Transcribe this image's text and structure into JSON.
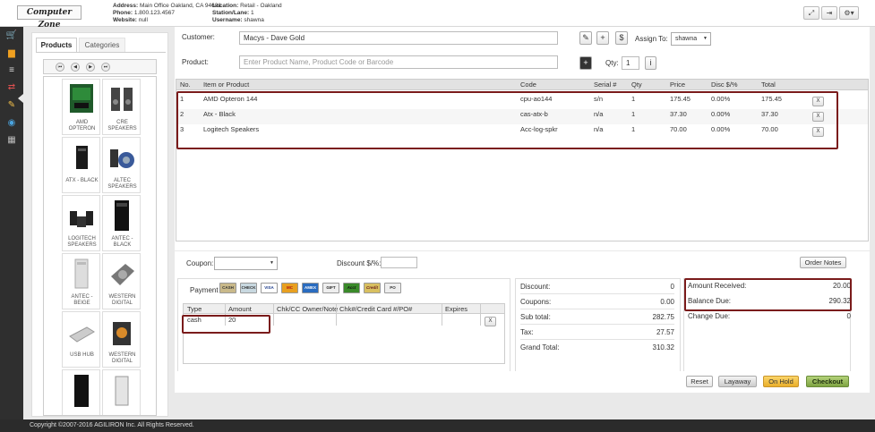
{
  "header": {
    "logo": "Computer Zone",
    "address_label": "Address:",
    "address": "Main Office Oakland, CA 94601",
    "phone_label": "Phone:",
    "phone": "1.800.123.4567",
    "website_label": "Website:",
    "website": "null",
    "location_label": "Location:",
    "location": "Retail - Oakland",
    "station_label": "Station/Lane:",
    "station": "1",
    "username_label": "Username:",
    "username": "shawna",
    "icons": [
      "expand-icon",
      "logout-icon",
      "gear-icon"
    ]
  },
  "rail": {
    "icons": [
      "cart-icon",
      "basket-icon",
      "register-icon",
      "transfer-icon",
      "edit-icon",
      "money-icon",
      "grid-icon"
    ]
  },
  "products_panel": {
    "tabs": [
      "Products",
      "Categories"
    ],
    "pager_icons": [
      "first-icon",
      "prev-icon",
      "next-icon",
      "last-icon"
    ],
    "pager_glyphs": [
      "⏮",
      "◀",
      "▶",
      "⏭"
    ],
    "tiles": [
      {
        "label": "AMD OPTERON"
      },
      {
        "label": "CRE SPEAKERS"
      },
      {
        "label": "ATX - BLACK"
      },
      {
        "label": "ALTEC SPEAKERS"
      },
      {
        "label": "LOGITECH SPEAKERS"
      },
      {
        "label": "ANTEC - BLACK"
      },
      {
        "label": "ANTEC - BEIGE"
      },
      {
        "label": "WESTERN DIGITAL"
      },
      {
        "label": "USB HUB"
      },
      {
        "label": "WESTERN DIGITAL"
      },
      {
        "label": ""
      },
      {
        "label": ""
      }
    ]
  },
  "order": {
    "customer_label": "Customer:",
    "customer_value": "Macys - Dave Gold",
    "product_label": "Product:",
    "product_placeholder": "Enter Product Name, Product Code or Barcode",
    "assign_label": "Assign To:",
    "assign_value": "shawna",
    "qty_label": "Qty:",
    "qty_value": "1",
    "edit_glyph": "✎",
    "add_glyph": "+",
    "dollar_glyph": "$",
    "plus_glyph": "+",
    "info_glyph": "i"
  },
  "cart": {
    "columns": [
      "No.",
      "Item or Product",
      "Code",
      "Serial #",
      "Qty",
      "Price",
      "Disc $/%",
      "Total"
    ],
    "remove_label": "X",
    "rows": [
      {
        "no": "1",
        "item": "AMD Opteron 144",
        "code": "cpu-ao144",
        "serial": "s/n",
        "qty": "1",
        "price": "175.45",
        "disc": "0.00%",
        "total": "175.45"
      },
      {
        "no": "2",
        "item": "Atx - Black",
        "code": "cas-atx-b",
        "serial": "n/a",
        "qty": "1",
        "price": "37.30",
        "disc": "0.00%",
        "total": "37.30"
      },
      {
        "no": "3",
        "item": "Logitech Speakers",
        "code": "Acc-log-spkr",
        "serial": "n/a",
        "qty": "1",
        "price": "70.00",
        "disc": "0.00%",
        "total": "70.00"
      }
    ]
  },
  "coupon": {
    "label": "Coupon:",
    "discount_label": "Discount $/%:",
    "order_notes": "Order Notes"
  },
  "payment": {
    "label": "Payment",
    "cards": [
      "CASH",
      "CHECK",
      "VISA",
      "MC",
      "AMEX",
      "GIFT",
      "Acct",
      "Credit",
      "PO"
    ],
    "columns": [
      "Type",
      "Amount",
      "Chk/CC Owner/Note",
      "Chk#/Credit Card #/PO#",
      "Expires"
    ],
    "row": {
      "type": "cash",
      "amount": "20"
    },
    "remove_label": "X"
  },
  "totals": [
    {
      "label": "Discount:",
      "value": "0"
    },
    {
      "label": "Coupons:",
      "value": "0.00"
    },
    {
      "label": "Sub total:",
      "value": "282.75"
    },
    {
      "label": "Tax:",
      "value": "27.57"
    },
    {
      "label": "Grand Total:",
      "value": "310.32"
    }
  ],
  "received": [
    {
      "label": "Amount Received:",
      "value": "20.00"
    },
    {
      "label": "Balance Due:",
      "value": "290.32"
    },
    {
      "label": "Change Due:",
      "value": "0"
    }
  ],
  "actions": {
    "reset": "Reset",
    "layaway": "Layaway",
    "on_hold": "On Hold",
    "checkout": "Checkout"
  },
  "footer": {
    "copyright": "Copyright ©2007-2016 AGILIRON Inc. All Rights Reserved."
  },
  "colors": {
    "highlight": "#7a1b1b",
    "rail": "#2f2f2f",
    "checkout": "#8fb253",
    "on_hold": "#f1c24a"
  }
}
